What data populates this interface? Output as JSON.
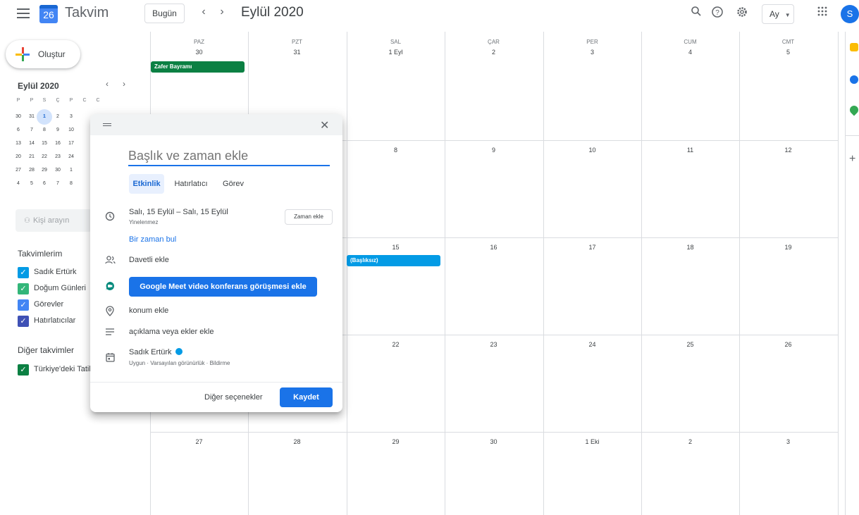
{
  "header": {
    "app_name": "Takvim",
    "logo_day": "26",
    "today_label": "Bugün",
    "prev_icon": "‹",
    "next_icon": "›",
    "month_title": "Eylül 2020",
    "view_label": "Ay",
    "avatar_initial": "S"
  },
  "sidebar": {
    "create_label": "Oluştur",
    "mini_month": "Eylül 2020",
    "mini_prev": "‹",
    "mini_next": "›",
    "mini_days": [
      "P",
      "P",
      "S",
      "Ç",
      "P",
      "C",
      "C"
    ],
    "mini_weeks": [
      [
        "30",
        "31",
        "1",
        "2",
        "3"
      ],
      [
        "6",
        "7",
        "8",
        "9",
        "10"
      ],
      [
        "13",
        "14",
        "15",
        "16",
        "17"
      ],
      [
        "20",
        "21",
        "22",
        "23",
        "24"
      ],
      [
        "27",
        "28",
        "29",
        "30",
        "1"
      ],
      [
        "4",
        "5",
        "6",
        "7",
        "8"
      ]
    ],
    "people_placeholder": "Kişi arayın",
    "my_calendars_title": "Takvimlerim",
    "my_calendars": [
      {
        "label": "Sadık Ertürk",
        "color": "#039be5"
      },
      {
        "label": "Doğum Günleri",
        "color": "#33b679"
      },
      {
        "label": "Görevler",
        "color": "#4285f4"
      },
      {
        "label": "Hatırlatıcılar",
        "color": "#3f51b5"
      }
    ],
    "other_calendars_title": "Diğer takvimler",
    "other_calendars": [
      {
        "label": "Türkiye'deki Tatil",
        "color": "#0b8043"
      }
    ]
  },
  "grid": {
    "day_headers": [
      "PAZ",
      "PZT",
      "SAL",
      "ÇAR",
      "PER",
      "CUM",
      "CMT"
    ],
    "weeks": [
      [
        "30",
        "31",
        "1 Eyl",
        "2",
        "3",
        "4",
        "5"
      ],
      [
        "",
        "",
        "8",
        "9",
        "10",
        "11",
        "12"
      ],
      [
        "",
        "",
        "15",
        "16",
        "17",
        "18",
        "19"
      ],
      [
        "",
        "",
        "22",
        "23",
        "24",
        "25",
        "26"
      ],
      [
        "27",
        "28",
        "29",
        "30",
        "1 Eki",
        "2",
        "3"
      ]
    ],
    "events": {
      "holiday": {
        "label": "Zafer Bayramı",
        "color": "#0b8043"
      },
      "untitled": {
        "label": "(Başlıksız)",
        "color": "#039be5"
      }
    }
  },
  "dialog": {
    "title_placeholder": "Başlık ve zaman ekle",
    "tabs": [
      "Etkinlik",
      "Hatırlatıcı",
      "Görev"
    ],
    "date_range": "Salı, 15 Eylül  –  Salı, 15 Eylül",
    "repeat": "Yinelenmez",
    "add_time": "Zaman ekle",
    "find_time": "Bir zaman bul",
    "add_guests": "Davetli ekle",
    "meet_button": "Google Meet video konferans görüşmesi ekle",
    "add_location": "konum ekle",
    "add_description": "açıklama veya ekler ekle",
    "owner": "Sadık Ertürk",
    "owner_details": "Uygun · Varsayılan görünürlük · Bildirme",
    "more_options": "Diğer seçenekler",
    "save": "Kaydet"
  }
}
